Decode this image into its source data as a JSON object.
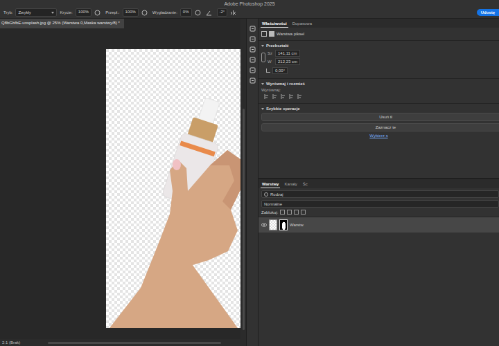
{
  "window": {
    "title": "Adobe Photoshop 2025"
  },
  "share_button": "Udostę",
  "options_bar": [
    {
      "label": "Tryb:",
      "value": "Zwykły",
      "kind": "dropdown"
    },
    {
      "label": "Krycie:",
      "value": "100%",
      "kind": "field"
    },
    {
      "label": "Przepł.:",
      "value": "100%",
      "kind": "field"
    },
    {
      "label": "Wygładzanie:",
      "value": "0%",
      "kind": "field"
    }
  ],
  "angle": "-2°",
  "document_tab": {
    "title": "Q8bGbfbE-unsplash.jpg @ 25% (Warstwa 0,Maska warstwy/8) *",
    "selected": true
  },
  "status_bar": "2:1 (Brak)",
  "properties": {
    "tabs": [
      {
        "label": "Właściwości",
        "selected": true
      },
      {
        "label": "Dopasowa",
        "selected": false
      }
    ],
    "layer_type": "Warstwa piksel",
    "transform": {
      "title": "Przekształć",
      "width_label": "Sz",
      "width": "141,11 cm",
      "height_label": "W",
      "height": "212,23 cm",
      "angle": "0,00°"
    },
    "align": {
      "title": "Wyrównaj i rozmieś",
      "label": "Wyrównaj:"
    },
    "quick_actions": {
      "title": "Szybkie operacje",
      "buttons": [
        "Usuń tł",
        "Zaznacz te"
      ],
      "link": "Wybierz s"
    }
  },
  "layers_panel": {
    "tabs": [
      {
        "label": "Warstwy",
        "selected": true
      },
      {
        "label": "Kanały",
        "selected": false
      },
      {
        "label": "Śc",
        "selected": false
      }
    ],
    "filter": "Rodzaj",
    "blend_mode": "Normalne",
    "lock_label": "Zablokuj:",
    "layers": [
      {
        "name": "Warstw",
        "visible": true,
        "selected": true
      }
    ]
  }
}
